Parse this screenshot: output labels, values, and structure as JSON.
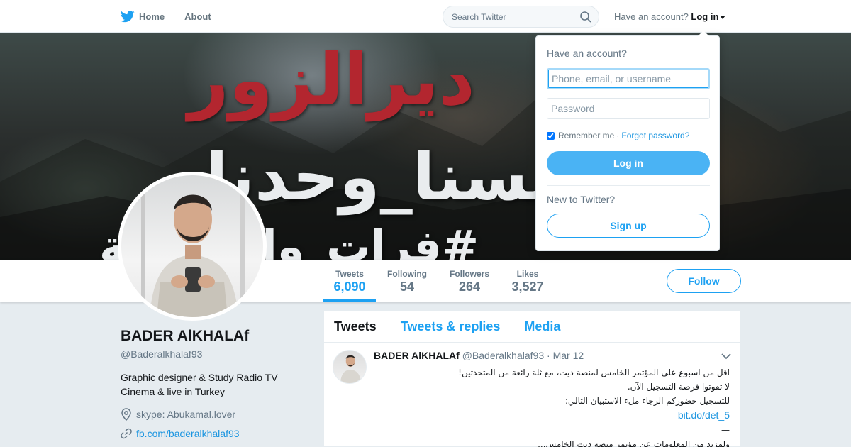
{
  "nav": {
    "home_label": "Home",
    "about_label": "About",
    "search_placeholder": "Search Twitter",
    "have_account": "Have an account?",
    "login_label": "Log in"
  },
  "banner": {
    "line1": "ديرالزور",
    "line2": "#لسنا_وحدنا",
    "line3": "#فرات_واحد_دبلة"
  },
  "profile": {
    "name": "BADER AlKHALAf",
    "handle": "@Baderalkhalaf93",
    "bio_line1": "Graphic designer & Study Radio TV",
    "bio_line2": "Cinema & live in Turkey",
    "location": "skype: Abukamal.lover",
    "website": "fb.com/baderalkhalaf93"
  },
  "stats": [
    {
      "label": "Tweets",
      "value": "6,090"
    },
    {
      "label": "Following",
      "value": "54"
    },
    {
      "label": "Followers",
      "value": "264"
    },
    {
      "label": "Likes",
      "value": "3,527"
    }
  ],
  "follow_label": "Follow",
  "timeline": {
    "tabs": [
      "Tweets",
      "Tweets & replies",
      "Media"
    ],
    "active_tab": 0,
    "tweet": {
      "name": "BADER AlKHALAf",
      "handle": "@Baderalkhalaf93",
      "sep": "·",
      "date": "Mar 12",
      "line1": "اقل من اسبوع على المؤتمر الخامس لمنصة ديت، مع ثلة رائعة من المتحدثين!",
      "line2": "لا تفوتوا فرصة التسجيل الآن.",
      "line3": "للتسجيل حضوركم الرجاء ملء الاستبيان التالي:",
      "link": "bit.do/det_5",
      "line4": "—",
      "line5": "ولمزيد من المعلومات عن مؤتمر منصة ديت الخامس..."
    }
  },
  "login_dropdown": {
    "title": "Have an account?",
    "username_placeholder": "Phone, email, or username",
    "password_placeholder": "Password",
    "remember_label": "Remember me",
    "dot": "·",
    "forgot_label": "Forgot password?",
    "login_button": "Log in",
    "new_label": "New to Twitter?",
    "signup_button": "Sign up"
  },
  "colors": {
    "accent": "#1da1f2",
    "banner_red": "#b3262f",
    "background": "#e6ecf0"
  },
  "icons": {
    "logo": "twitter-bird-icon",
    "search": "search-icon",
    "location": "location-pin-icon",
    "link": "link-icon",
    "tweet_menu": "chevron-down-icon"
  }
}
